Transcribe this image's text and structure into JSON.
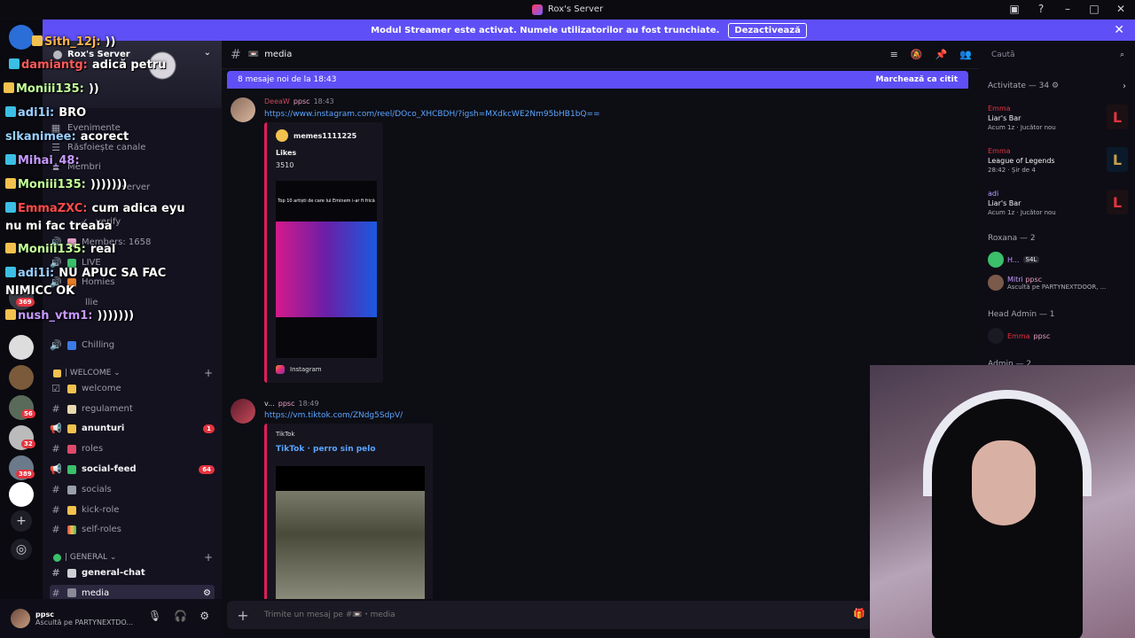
{
  "window": {
    "title": "Rox's Server"
  },
  "banner": {
    "text": "Modul Streamer este activat. Numele utilizatorilor au fost trunchiate.",
    "button": "Dezactivează"
  },
  "sidebar": {
    "server_name": "Rox's Server",
    "rows": [
      {
        "label": "Evenimente",
        "icon": "calendar-icon"
      },
      {
        "label": "Răsfoiește canale",
        "icon": "browse-icon"
      },
      {
        "label": "Membri",
        "icon": "members-icon"
      },
      {
        "label": "u server",
        "icon": ""
      },
      {
        "label": "verify",
        "icon": "check-icon"
      },
      {
        "label": "Members: 1658",
        "icon": "speaker-icon"
      },
      {
        "label": "LIVE",
        "icon": "speaker-icon"
      },
      {
        "label": "Homies",
        "icon": "speaker-icon"
      },
      {
        "label": "llie",
        "icon": ""
      },
      {
        "label": "Chilling",
        "icon": "speaker-icon"
      }
    ],
    "categories": [
      {
        "label": "| WELCOME"
      },
      {
        "label": "| GENERAL"
      }
    ],
    "channels": [
      {
        "label": "welcome",
        "type": "rules"
      },
      {
        "label": "regulament",
        "type": "text"
      },
      {
        "label": "anunturi",
        "type": "announce",
        "count": "1"
      },
      {
        "label": "roles",
        "type": "text"
      },
      {
        "label": "social-feed",
        "type": "announce",
        "count": "64"
      },
      {
        "label": "socials",
        "type": "text"
      },
      {
        "label": "kick-role",
        "type": "text"
      },
      {
        "label": "self-roles",
        "type": "text"
      },
      {
        "label": "general-chat",
        "type": "text"
      },
      {
        "label": "media",
        "type": "text"
      }
    ]
  },
  "rail": {
    "badges": [
      "369",
      "56",
      "32",
      "389"
    ]
  },
  "overlay": {
    "lines": [
      {
        "name": "Sith_12j:",
        "text": "))"
      },
      {
        "name": "damiantg:",
        "text": "adică petru"
      },
      {
        "name": "Moniii135:",
        "text": "))"
      },
      {
        "name": "adi1i:",
        "text": "BRO"
      },
      {
        "name": "slkanimee:",
        "text": "acorect"
      },
      {
        "name": "Mihai_48:",
        "text": ""
      },
      {
        "name": "Moniii135:",
        "text": ")))))))"
      },
      {
        "name": "EmmaZXC:",
        "text": "cum adica eyu"
      },
      {
        "name": "",
        "text": "nu mi fac treaba"
      },
      {
        "name": "Moniii135:",
        "text": "real"
      },
      {
        "name": "adi1i:",
        "text": "NU APUC SA FAC"
      },
      {
        "name": "",
        "text": "NIMICC OK"
      },
      {
        "name": "nush_vtm1:",
        "text": ")))))))"
      }
    ]
  },
  "channel": {
    "name": "media",
    "new_messages": "8 mesaje noi de la 18:43",
    "mark_read": "Marchează ca citit"
  },
  "messages": [
    {
      "author": "DeeaW",
      "tag": "ppsc",
      "time": "18:43",
      "link": "https://www.instagram.com/reel/DOco_XHCBDH/?igsh=MXdkcWE2Nm95bHB1bQ==",
      "embed": {
        "author": "memes1111225",
        "title": "Likes",
        "sub": "3510",
        "image_caption": "Top 10 artiști de care lui Eminem i-ar fi frică",
        "footer": "Instagram"
      }
    },
    {
      "author": "v...",
      "tag": "ppsc",
      "time": "18:49",
      "link": "https://vm.tiktok.com/ZNdg5SdpV/",
      "embed": {
        "provider": "TikTok",
        "title": "TikTok · perro sin pelo"
      }
    }
  ],
  "composer": {
    "placeholder": "Trimite un mesaj pe #📼・media"
  },
  "rightpanel": {
    "search": "Caută",
    "activity_head": "Activitate — 34",
    "activities": [
      {
        "name": "Emma",
        "game": "Liar's Bar",
        "time": "Acum 1z",
        "status": "Jucător nou"
      },
      {
        "name": "Emma",
        "game": "League of Legends",
        "time": "28:42",
        "status": "Șir de 4"
      },
      {
        "name": "adi",
        "game": "Liar's Bar",
        "time": "Acum 1z",
        "status": "Jucător nou"
      }
    ],
    "roxana_head": "Roxana — 2",
    "roxana_members": [
      {
        "name": "H...",
        "extra": "S4L"
      },
      {
        "name": "Mitri",
        "extra": "ppsc",
        "status": "Ascultă pe PARTYNEXTDOOR, ..."
      }
    ],
    "headadmin_head": "Head Admin — 1",
    "headadmin_members": [
      {
        "name": "Emma",
        "extra": "ppsc"
      }
    ],
    "admin_head": "Admin — 2"
  },
  "user": {
    "name": "ppsc",
    "status": "Ascultă pe PARTYNEXTDO..."
  },
  "colors": {
    "accent": "#5f4ff6",
    "danger": "#e5343f",
    "link": "#5aa5ff"
  }
}
